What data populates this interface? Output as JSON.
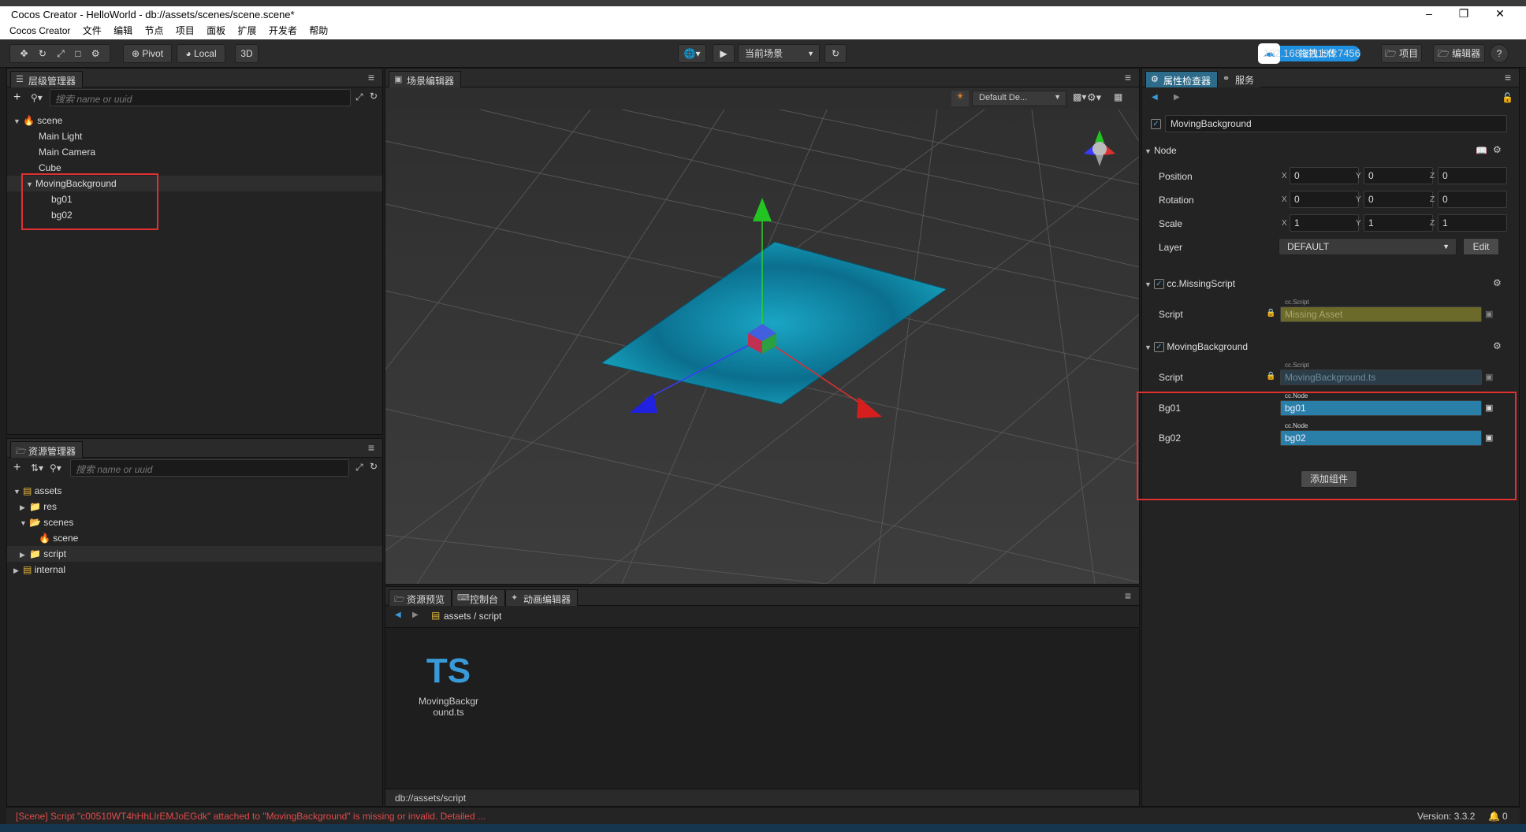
{
  "window": {
    "title": "Cocos Creator - HelloWorld - db://assets/scenes/scene.scene*"
  },
  "menu": [
    "Cocos Creator",
    "文件",
    "编辑",
    "节点",
    "项目",
    "面板",
    "扩展",
    "开发者",
    "帮助"
  ],
  "toolbar": {
    "pivot": "Pivot",
    "local": "Local",
    "three_d": "3D",
    "scene_select": "当前场景",
    "ip": "192.168.27.193:7456",
    "project_btn": "项目",
    "editor_btn": "编辑器",
    "upload_badge": "拖拽上传"
  },
  "hierarchy": {
    "tab": "层级管理器",
    "search_placeholder": "搜索 name or uuid",
    "nodes": [
      {
        "label": "scene",
        "depth": 0,
        "expanded": true,
        "icon": "fire-icon"
      },
      {
        "label": "Main Light",
        "depth": 1
      },
      {
        "label": "Main Camera",
        "depth": 1
      },
      {
        "label": "Cube",
        "depth": 1
      },
      {
        "label": "MovingBackground",
        "depth": 1,
        "expanded": true,
        "selected": true
      },
      {
        "label": "bg01",
        "depth": 2
      },
      {
        "label": "bg02",
        "depth": 2
      }
    ]
  },
  "assets": {
    "tab": "资源管理器",
    "search_placeholder": "搜索 name or uuid",
    "items": [
      {
        "label": "assets",
        "depth": 0,
        "expanded": true
      },
      {
        "label": "res",
        "depth": 1
      },
      {
        "label": "scenes",
        "depth": 1,
        "expanded": true
      },
      {
        "label": "scene",
        "depth": 2
      },
      {
        "label": "script",
        "depth": 1,
        "selected": true
      },
      {
        "label": "internal",
        "depth": 0
      }
    ]
  },
  "scene_editor": {
    "tab": "场景编辑器",
    "camera_select": "Default De..."
  },
  "bottom": {
    "tabs": [
      "资源预览",
      "控制台",
      "动画编辑器"
    ],
    "path": "assets / script",
    "file_icon": "TS",
    "file_name_1": "MovingBackgr",
    "file_name_2": "ound.ts",
    "footer_path": "db://assets/script"
  },
  "inspector": {
    "tabs": [
      "属性检查器",
      "服务"
    ],
    "node_name": "MovingBackground",
    "node_section": "Node",
    "position": {
      "label": "Position",
      "x": "0",
      "y": "0",
      "z": "0"
    },
    "rotation": {
      "label": "Rotation",
      "x": "0",
      "y": "0",
      "z": "0"
    },
    "scale": {
      "label": "Scale",
      "x": "1",
      "y": "1",
      "z": "1"
    },
    "layer": {
      "label": "Layer",
      "value": "DEFAULT",
      "edit": "Edit"
    },
    "missing_section": "cc.MissingScript",
    "missing_script": {
      "label": "Script",
      "type": "cc.Script",
      "value": "Missing Asset"
    },
    "mb_section": "MovingBackground",
    "mb_script": {
      "label": "Script",
      "type": "cc.Script",
      "value": "MovingBackground.ts"
    },
    "bg01": {
      "label": "Bg01",
      "type": "cc.Node",
      "value": "bg01"
    },
    "bg02": {
      "label": "Bg02",
      "type": "cc.Node",
      "value": "bg02"
    },
    "add_component": "添加组件",
    "axes": {
      "x": "X",
      "y": "Y",
      "z": "Z"
    }
  },
  "status": {
    "error": "[Scene] Script \"c00510WT4hHhLlrEMJoEGdk\" attached to \"MovingBackground\" is missing or invalid. Detailed ...",
    "version": "Version: 3.3.2",
    "notifications": "0"
  },
  "colors": {
    "accent": "#2d6b8a",
    "error_text": "#e04a4a",
    "highlight_box": "#e03030",
    "missing_field": "#6b6a2a",
    "node_field": "#2a7fa8"
  }
}
